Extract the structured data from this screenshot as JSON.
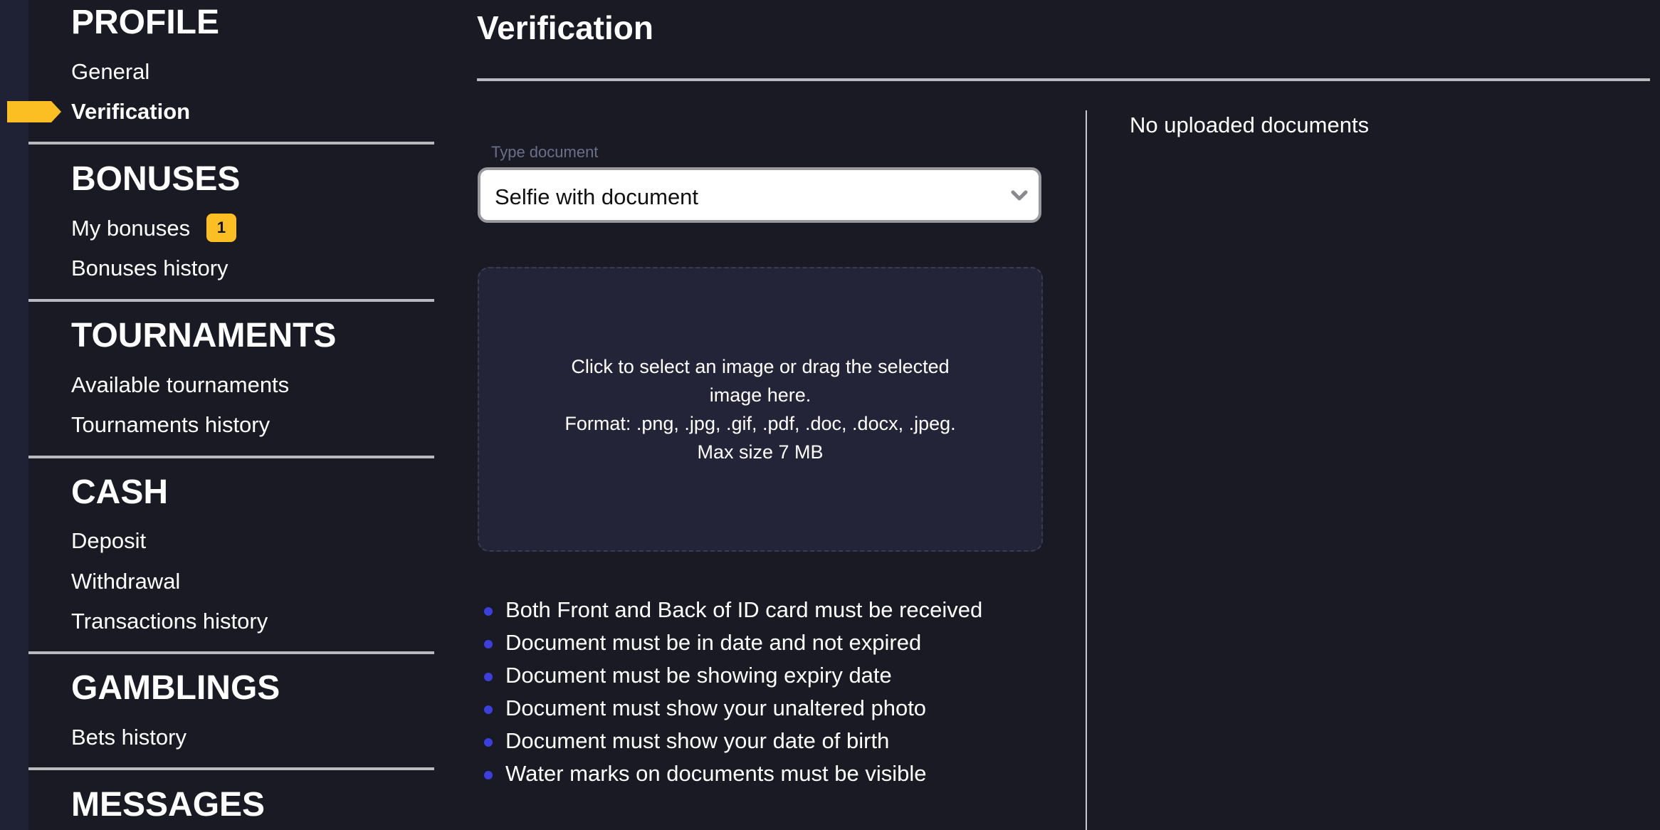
{
  "sidebar": {
    "sections": [
      {
        "title": "PROFILE",
        "items": [
          {
            "label": "General"
          },
          {
            "label": "Verification",
            "active": true
          }
        ]
      },
      {
        "title": "BONUSES",
        "items": [
          {
            "label": "My bonuses",
            "badge": "1"
          },
          {
            "label": "Bonuses history"
          }
        ]
      },
      {
        "title": "TOURNAMENTS",
        "items": [
          {
            "label": "Available tournaments"
          },
          {
            "label": "Tournaments history"
          }
        ]
      },
      {
        "title": "CASH",
        "items": [
          {
            "label": "Deposit"
          },
          {
            "label": "Withdrawal"
          },
          {
            "label": "Transactions history"
          }
        ]
      },
      {
        "title": "GAMBLINGS",
        "items": [
          {
            "label": "Bets history"
          }
        ]
      },
      {
        "title": "MESSAGES",
        "items": []
      }
    ],
    "active_marker_icon": "arrow-tag-icon"
  },
  "main": {
    "title": "Verification",
    "document_type": {
      "label": "Type document",
      "selected": "Selfie with document",
      "icon": "chevron-down-icon"
    },
    "upload": {
      "line1": "Click to select an image or drag the selected",
      "line2": "image here.",
      "line3": "Format: .png, .jpg, .gif, .pdf, .doc, .docx, .jpeg.",
      "line4": "Max size 7 MB"
    },
    "requirements": [
      "Both Front and Back of ID card must be received",
      "Document must be in date and not expired",
      "Document must be showing expiry date",
      "Document must show your unaltered photo",
      "Document must show your date of birth",
      "Water marks on documents must be visible"
    ],
    "uploaded_documents_empty": "No uploaded documents"
  },
  "colors": {
    "background": "#191a24",
    "left_strip": "#1f2134",
    "accent_yellow": "#fbbf24",
    "bullet_blue": "#3b3fe0",
    "separator": "#b8b8bd",
    "upload_box": "#232437",
    "label_muted": "#6b6f8a"
  }
}
